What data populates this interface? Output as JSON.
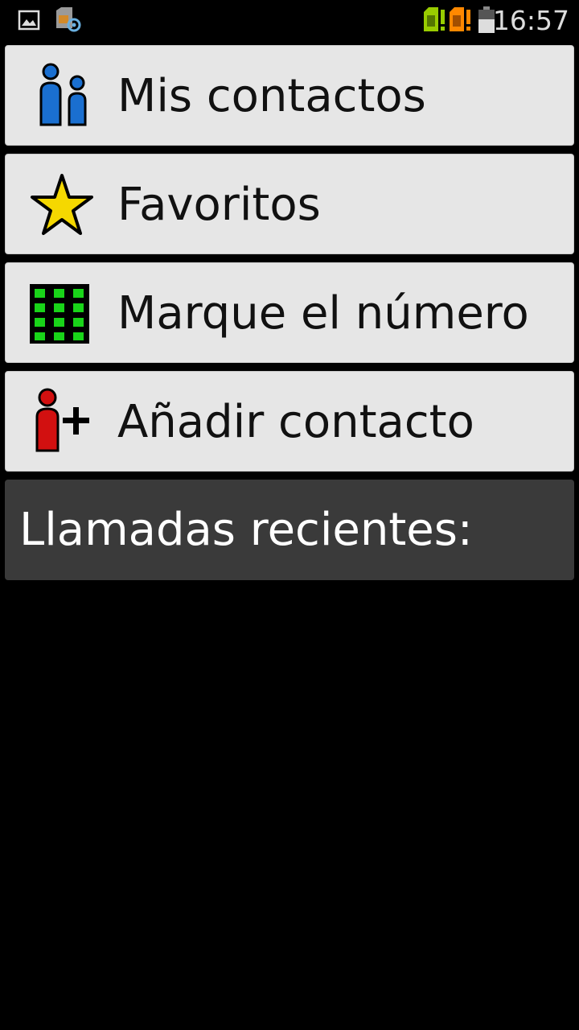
{
  "status_bar": {
    "time": "16:57",
    "icons": [
      "image-icon",
      "sd-settings-icon",
      "sim1-alert-icon",
      "sim2-alert-icon",
      "battery-icon"
    ],
    "colors": {
      "sim1": "#99cc00",
      "sim2": "#ff8800"
    }
  },
  "menu": {
    "items": [
      {
        "label": "Mis contactos",
        "icon": "contacts-icon"
      },
      {
        "label": "Favoritos",
        "icon": "star-icon"
      },
      {
        "label": "Marque el número",
        "icon": "dialpad-icon"
      },
      {
        "label": "Añadir contacto",
        "icon": "add-contact-icon"
      }
    ]
  },
  "recent": {
    "label": "Llamadas recientes:"
  }
}
